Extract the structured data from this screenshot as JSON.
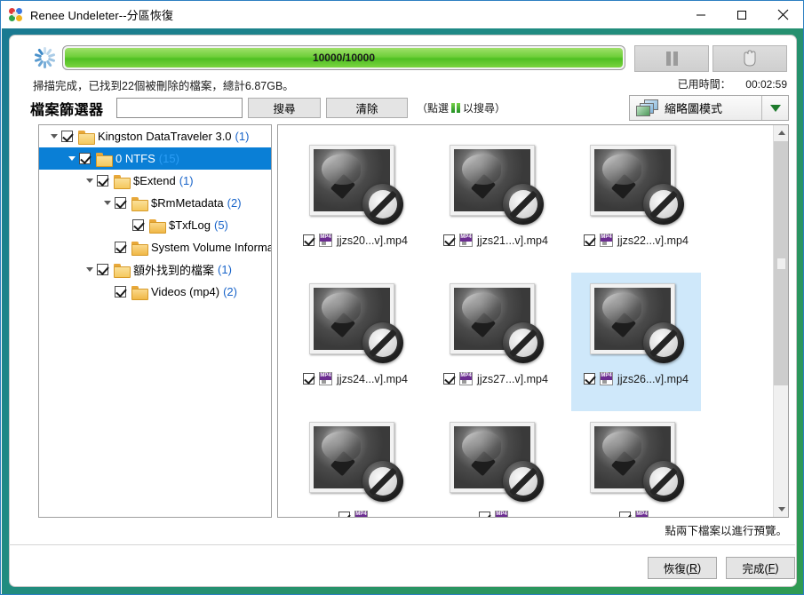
{
  "window": {
    "title": "Renee Undeleter--分區恢復",
    "app_icon": "pinwheel-icon",
    "minimize_label": "minimize-icon",
    "maximize_label": "maximize-icon",
    "close_label": "close-icon",
    "frame_color": "#1f8a85"
  },
  "progress": {
    "value_label": "10000/10000",
    "percent": 100,
    "bar_color": "#5ec32a",
    "spinner_icon": "loading-spinner-icon",
    "pause_icon": "pause-icon",
    "stop_icon": "stop-hand-icon",
    "status_text": "掃描完成，已找到22個被刪除的檔案，總計6.87GB。",
    "elapsed_label": "已用時間：",
    "elapsed_value": "00:02:59"
  },
  "filter": {
    "label": "檔案篩選器",
    "input_value": "",
    "input_placeholder": "",
    "search_button": "搜尋",
    "clear_button": "清除",
    "hint_prefix": "（點選",
    "hint_icon": "green-pause-icon",
    "hint_suffix": "以搜尋）"
  },
  "view_mode": {
    "icon": "thumbnail-mode-icon",
    "label": "縮略圖模式",
    "arrow_icon": "chevron-down-icon"
  },
  "tree": {
    "items": [
      {
        "label": "Kingston DataTraveler 3.0",
        "count": "(1)",
        "indent": 0,
        "expanded": true,
        "has_toggle": true,
        "checked": true,
        "selected": false
      },
      {
        "label": "0 NTFS",
        "count": "(15)",
        "indent": 1,
        "expanded": true,
        "has_toggle": true,
        "checked": true,
        "selected": true
      },
      {
        "label": "$Extend",
        "count": "(1)",
        "indent": 2,
        "expanded": true,
        "has_toggle": true,
        "checked": true,
        "selected": false
      },
      {
        "label": "$RmMetadata",
        "count": "(2)",
        "indent": 3,
        "expanded": true,
        "has_toggle": true,
        "checked": true,
        "selected": false
      },
      {
        "label": "$TxfLog",
        "count": "(5)",
        "indent": 4,
        "expanded": false,
        "has_toggle": false,
        "checked": true,
        "selected": false
      },
      {
        "label": "System Volume Information",
        "count": "",
        "indent": 3,
        "expanded": false,
        "has_toggle": false,
        "checked": true,
        "selected": false
      },
      {
        "label": "額外找到的檔案",
        "count": "(1)",
        "indent": 2,
        "expanded": true,
        "has_toggle": true,
        "checked": true,
        "selected": false
      },
      {
        "label": "Videos (mp4)",
        "count": "(2)",
        "indent": 3,
        "expanded": false,
        "has_toggle": false,
        "checked": true,
        "selected": false
      }
    ]
  },
  "thumbnails": {
    "items": [
      {
        "name": "jjzs20...v].mp4",
        "checked": true,
        "selected": false,
        "icon": "mp4-file-icon",
        "thumb": "unavailable-image-icon"
      },
      {
        "name": "jjzs21...v].mp4",
        "checked": true,
        "selected": false,
        "icon": "mp4-file-icon",
        "thumb": "unavailable-image-icon"
      },
      {
        "name": "jjzs22...v].mp4",
        "checked": true,
        "selected": false,
        "icon": "mp4-file-icon",
        "thumb": "unavailable-image-icon"
      },
      {
        "name": "jjzs24...v].mp4",
        "checked": true,
        "selected": false,
        "icon": "mp4-file-icon",
        "thumb": "unavailable-image-icon"
      },
      {
        "name": "jjzs27...v].mp4",
        "checked": true,
        "selected": false,
        "icon": "mp4-file-icon",
        "thumb": "unavailable-image-icon"
      },
      {
        "name": "jjzs26...v].mp4",
        "checked": true,
        "selected": true,
        "icon": "mp4-file-icon",
        "thumb": "unavailable-image-icon"
      },
      {
        "name": "",
        "checked": true,
        "selected": false,
        "icon": "mp4-file-icon",
        "thumb": "unavailable-image-icon"
      },
      {
        "name": "",
        "checked": true,
        "selected": false,
        "icon": "mp4-file-icon",
        "thumb": "unavailable-image-icon"
      },
      {
        "name": "",
        "checked": true,
        "selected": false,
        "icon": "mp4-file-icon",
        "thumb": "unavailable-image-icon"
      }
    ],
    "selection_color": "#cfe8fa"
  },
  "footer": {
    "preview_hint": "點兩下檔案以進行預覽。",
    "restore_button": "恢復(R)",
    "finish_button": "完成(F)"
  }
}
